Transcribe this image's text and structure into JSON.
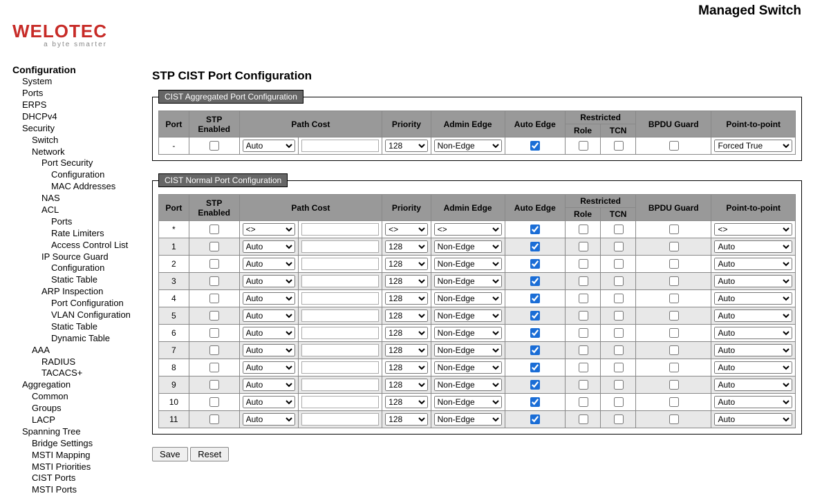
{
  "header": {
    "title": "Managed Switch"
  },
  "logo": {
    "text": "WELOTEC",
    "tagline": "a byte smarter"
  },
  "sidebar": [
    {
      "label": "Configuration",
      "level": 0
    },
    {
      "label": "System",
      "level": 1
    },
    {
      "label": "Ports",
      "level": 1
    },
    {
      "label": "ERPS",
      "level": 1
    },
    {
      "label": "DHCPv4",
      "level": 1
    },
    {
      "label": "Security",
      "level": 1
    },
    {
      "label": "Switch",
      "level": 2
    },
    {
      "label": "Network",
      "level": 2
    },
    {
      "label": "Port Security",
      "level": 3
    },
    {
      "label": "Configuration",
      "level": 4
    },
    {
      "label": "MAC Addresses",
      "level": 4
    },
    {
      "label": "NAS",
      "level": 3
    },
    {
      "label": "ACL",
      "level": 3
    },
    {
      "label": "Ports",
      "level": 4
    },
    {
      "label": "Rate Limiters",
      "level": 4
    },
    {
      "label": "Access Control List",
      "level": 4
    },
    {
      "label": "IP Source Guard",
      "level": 3
    },
    {
      "label": "Configuration",
      "level": 4
    },
    {
      "label": "Static Table",
      "level": 4
    },
    {
      "label": "ARP Inspection",
      "level": 3
    },
    {
      "label": "Port Configuration",
      "level": 4
    },
    {
      "label": "VLAN Configuration",
      "level": 4
    },
    {
      "label": "Static Table",
      "level": 4
    },
    {
      "label": "Dynamic Table",
      "level": 4
    },
    {
      "label": "AAA",
      "level": 2
    },
    {
      "label": "RADIUS",
      "level": 3
    },
    {
      "label": "TACACS+",
      "level": 3
    },
    {
      "label": "Aggregation",
      "level": 1
    },
    {
      "label": "Common",
      "level": 2
    },
    {
      "label": "Groups",
      "level": 2
    },
    {
      "label": "LACP",
      "level": 2
    },
    {
      "label": "Spanning Tree",
      "level": 1
    },
    {
      "label": "Bridge Settings",
      "level": 2
    },
    {
      "label": "MSTI Mapping",
      "level": 2
    },
    {
      "label": "MSTI Priorities",
      "level": 2
    },
    {
      "label": "CIST Ports",
      "level": 2
    },
    {
      "label": "MSTI Ports",
      "level": 2
    }
  ],
  "page": {
    "title": "STP CIST Port Configuration",
    "agg_legend": "CIST Aggregated Port Configuration",
    "norm_legend": "CIST Normal Port Configuration"
  },
  "columns": {
    "port": "Port",
    "stp": "STP Enabled",
    "pathcost": "Path Cost",
    "priority": "Priority",
    "admin_edge": "Admin Edge",
    "auto_edge": "Auto Edge",
    "restricted": "Restricted",
    "role": "Role",
    "tcn": "TCN",
    "bpdu": "BPDU Guard",
    "p2p": "Point-to-point"
  },
  "agg_row": {
    "port": "-",
    "stp": false,
    "pc_mode": "Auto",
    "pc_val": "",
    "priority": "128",
    "admin_edge": "Non-Edge",
    "auto_edge": true,
    "role": false,
    "tcn": false,
    "bpdu": false,
    "p2p": "Forced True"
  },
  "wildcard_row": {
    "port": "*",
    "stp": false,
    "pc_mode": "<>",
    "pc_val": "",
    "priority": "<>",
    "admin_edge": "<>",
    "auto_edge": true,
    "role": false,
    "tcn": false,
    "bpdu": false,
    "p2p": "<>"
  },
  "rows": [
    {
      "port": "1",
      "stp": false,
      "pc_mode": "Auto",
      "pc_val": "",
      "priority": "128",
      "admin_edge": "Non-Edge",
      "auto_edge": true,
      "role": false,
      "tcn": false,
      "bpdu": false,
      "p2p": "Auto"
    },
    {
      "port": "2",
      "stp": false,
      "pc_mode": "Auto",
      "pc_val": "",
      "priority": "128",
      "admin_edge": "Non-Edge",
      "auto_edge": true,
      "role": false,
      "tcn": false,
      "bpdu": false,
      "p2p": "Auto"
    },
    {
      "port": "3",
      "stp": false,
      "pc_mode": "Auto",
      "pc_val": "",
      "priority": "128",
      "admin_edge": "Non-Edge",
      "auto_edge": true,
      "role": false,
      "tcn": false,
      "bpdu": false,
      "p2p": "Auto"
    },
    {
      "port": "4",
      "stp": false,
      "pc_mode": "Auto",
      "pc_val": "",
      "priority": "128",
      "admin_edge": "Non-Edge",
      "auto_edge": true,
      "role": false,
      "tcn": false,
      "bpdu": false,
      "p2p": "Auto"
    },
    {
      "port": "5",
      "stp": false,
      "pc_mode": "Auto",
      "pc_val": "",
      "priority": "128",
      "admin_edge": "Non-Edge",
      "auto_edge": true,
      "role": false,
      "tcn": false,
      "bpdu": false,
      "p2p": "Auto"
    },
    {
      "port": "6",
      "stp": false,
      "pc_mode": "Auto",
      "pc_val": "",
      "priority": "128",
      "admin_edge": "Non-Edge",
      "auto_edge": true,
      "role": false,
      "tcn": false,
      "bpdu": false,
      "p2p": "Auto"
    },
    {
      "port": "7",
      "stp": false,
      "pc_mode": "Auto",
      "pc_val": "",
      "priority": "128",
      "admin_edge": "Non-Edge",
      "auto_edge": true,
      "role": false,
      "tcn": false,
      "bpdu": false,
      "p2p": "Auto"
    },
    {
      "port": "8",
      "stp": false,
      "pc_mode": "Auto",
      "pc_val": "",
      "priority": "128",
      "admin_edge": "Non-Edge",
      "auto_edge": true,
      "role": false,
      "tcn": false,
      "bpdu": false,
      "p2p": "Auto"
    },
    {
      "port": "9",
      "stp": false,
      "pc_mode": "Auto",
      "pc_val": "",
      "priority": "128",
      "admin_edge": "Non-Edge",
      "auto_edge": true,
      "role": false,
      "tcn": false,
      "bpdu": false,
      "p2p": "Auto"
    },
    {
      "port": "10",
      "stp": false,
      "pc_mode": "Auto",
      "pc_val": "",
      "priority": "128",
      "admin_edge": "Non-Edge",
      "auto_edge": true,
      "role": false,
      "tcn": false,
      "bpdu": false,
      "p2p": "Auto"
    },
    {
      "port": "11",
      "stp": false,
      "pc_mode": "Auto",
      "pc_val": "",
      "priority": "128",
      "admin_edge": "Non-Edge",
      "auto_edge": true,
      "role": false,
      "tcn": false,
      "bpdu": false,
      "p2p": "Auto"
    }
  ],
  "buttons": {
    "save": "Save",
    "reset": "Reset"
  }
}
